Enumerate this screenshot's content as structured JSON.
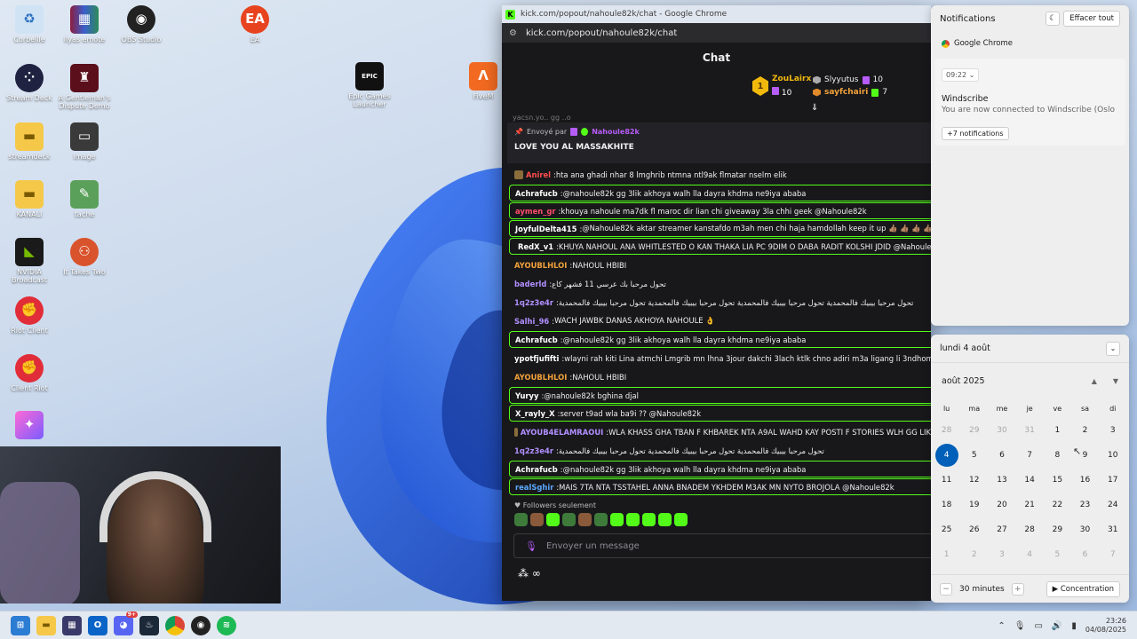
{
  "desktop": {
    "icons": [
      {
        "label": "Corbeille",
        "icon": "recycle-bin-icon"
      },
      {
        "label": "ilyas emote",
        "icon": "winrar-icon"
      },
      {
        "label": "OBS Studio",
        "icon": "obs-icon"
      },
      {
        "label": "EA",
        "icon": "ea-icon"
      },
      {
        "label": "Stream Deck",
        "icon": "stream-deck-icon"
      },
      {
        "label": "A Gentleman's Dispute Demo",
        "icon": "top-hat-icon"
      },
      {
        "label": "Epic Games Launcher",
        "icon": "epic-games-icon"
      },
      {
        "label": "FiveM",
        "icon": "fivem-icon"
      },
      {
        "label": "streamdeck",
        "icon": "folder-icon"
      },
      {
        "label": "image",
        "icon": "image-icon"
      },
      {
        "label": "KANALI",
        "icon": "folder-icon"
      },
      {
        "label": "tache",
        "icon": "image-icon"
      },
      {
        "label": "NVIDIA Broadcast",
        "icon": "nvidia-icon"
      },
      {
        "label": "It Takes Two",
        "icon": "it-takes-two-icon"
      },
      {
        "label": "Riot Client",
        "icon": "riot-icon"
      },
      {
        "label": "Client Riot",
        "icon": "riot-icon"
      }
    ]
  },
  "chrome": {
    "window_title": "kick.com/popout/nahoule82k/chat - Google Chrome",
    "url": "kick.com/popout/nahoule82k/chat",
    "favicon_letter": "K"
  },
  "chat": {
    "header": "Chat",
    "leaderboard": {
      "first": {
        "rank": "1",
        "name": "ZouLairx",
        "count": "10"
      },
      "second": {
        "name": "Slyyutus",
        "count": "10"
      },
      "third": {
        "name": "sayfchairi",
        "count": "7"
      }
    },
    "cut_line": "yacsn.yo.. gg ..o",
    "pinned": {
      "sent_by": "Envoyé par",
      "user": "Nahoule82k",
      "message": "LOVE YOU AL MASSAKHITE"
    },
    "messages": [
      {
        "user": "Anirel",
        "color": "#ff4d4d",
        "text": "hta ana ghadi nhar 8 lmghrib ntmna ntl9ak flmatar nselm elik",
        "hl": false,
        "badge": "#8a6d3b"
      },
      {
        "user": "Achrafucb",
        "color": "#ffffff",
        "text": "@nahoule82k gg 3lik akhoya walh lla dayra khdma ne9iya ababa",
        "hl": true,
        "badge": ""
      },
      {
        "user": "aymen_gr",
        "color": "#ff4d6a",
        "text": "khouya nahoule ma7dk fl maroc dir lian chi giveaway 3la chhi geek @Nahoule82k",
        "hl": true,
        "badge": ""
      },
      {
        "user": "JoyfulDelta415",
        "color": "#ffffff",
        "text": "@Nahoule82k aktar streamer kanstafdo m3ah men chi haja hamdollah keep it up 👍🏽 👍🏽 👍🏽 👍🏽 👍🏽",
        "hl": true,
        "badge": ""
      },
      {
        "user": "RedX_v1",
        "color": "#ffffff",
        "text": "KHUYA NAHOUL ANA WHITLESTED O KAN THAKA LIA PC 9DIM O DABA RADIT KOLSHI JDID @Nahoule82k",
        "hl": true,
        "badge": "#e7c04a"
      },
      {
        "user": "AYOUBLHLOI",
        "color": "#f2a23a",
        "text": "NAHOUL HBIBI",
        "hl": false,
        "badge": ""
      },
      {
        "user": "baderld",
        "color": "#b18fff",
        "text": "تحول مرحبا بك عرسي 11 فشهر كاع",
        "hl": false,
        "badge": ""
      },
      {
        "user": "1q2z3e4r",
        "color": "#b18fff",
        "text": "تحول مرحبا بيبيك فالمحمدية تحول مرحبا بيبيك فالمحمدية تحول مرحبا بيبيك فالمحمدية تحول مرحبا بيبيك فالمحمدية",
        "hl": false,
        "badge": ""
      },
      {
        "user": "Salhi_96",
        "color": "#b18fff",
        "text": "WACH JAWBK DANAS AKHOYA NAHOULE 👌",
        "hl": false,
        "badge": ""
      },
      {
        "user": "Achrafucb",
        "color": "#ffffff",
        "text": "@nahoule82k gg 3lik akhoya walh lla dayra khdma ne9iya ababa",
        "hl": true,
        "badge": ""
      },
      {
        "user": "ypotfjufifti",
        "color": "#ffffff",
        "text": "wlayni rah kiti Lina atmchi Lmgrib mn lhna 3jour dakchi 3lach ktlk chno adiri m3a ligang li 3ndhom slota",
        "hl": false,
        "badge": ""
      },
      {
        "user": "AYOUBLHLOI",
        "color": "#f2a23a",
        "text": "NAHOUL HBIBI",
        "hl": false,
        "badge": ""
      },
      {
        "user": "Yuryy",
        "color": "#ffffff",
        "text": "@nahoule82k bghina djal",
        "hl": true,
        "badge": ""
      },
      {
        "user": "X_rayly_X",
        "color": "#ffffff",
        "text": "server t9ad wla ba9i ?? @Nahoule82k",
        "hl": true,
        "badge": ""
      },
      {
        "user": "AYOUB4ELAMRAOUI",
        "color": "#b18fff",
        "text": "WLA KHASS GHA TBAN F KHBAREK NTA A9AL WAHD KAY POSTI F STORIES WLH GG LIK",
        "hl": false,
        "badge": "#8a6d3b"
      },
      {
        "user": "1q2z3e4r",
        "color": "#b18fff",
        "text": "تحول مرحبا بيبيك فالمحمدية تحول مرحبا بيبيك فالمحمدية تحول مرحبا بيبيك فالمحمدية",
        "hl": false,
        "badge": ""
      },
      {
        "user": "Achrafucb",
        "color": "#ffffff",
        "text": "@nahoule82k gg 3lik akhoya walh lla dayra khdma ne9iya ababa",
        "hl": true,
        "badge": ""
      },
      {
        "user": "realSghir",
        "color": "#5aa9ff",
        "text": "MAIS 7TA NTA TSSTAHEL ANNA BNADEM YKHDEM M3AK MN NYTO BROJOLA @Nahoule82k",
        "hl": true,
        "badge": ""
      }
    ],
    "followers_only": "Followers seulement",
    "input_placeholder": "Envoyer un message"
  },
  "notifications": {
    "title": "Notifications",
    "clear_all": "Effacer tout",
    "app": "Google Chrome",
    "time": "09:22",
    "card_title": "Windscribe",
    "card_body": "You are now connected to Windscribe (Oslo",
    "more": "+7 notifications"
  },
  "calendar": {
    "date_header": "lundi 4 août",
    "month": "août 2025",
    "weekdays": [
      "lu",
      "ma",
      "me",
      "je",
      "ve",
      "sa",
      "di"
    ],
    "days": [
      [
        "28",
        "out"
      ],
      [
        "29",
        "out"
      ],
      [
        "30",
        "out"
      ],
      [
        "31",
        "out"
      ],
      [
        "1",
        ""
      ],
      [
        "2",
        ""
      ],
      [
        "3",
        ""
      ],
      [
        "4",
        "today"
      ],
      [
        "5",
        ""
      ],
      [
        "6",
        ""
      ],
      [
        "7",
        ""
      ],
      [
        "8",
        ""
      ],
      [
        "9",
        ""
      ],
      [
        "10",
        ""
      ],
      [
        "11",
        ""
      ],
      [
        "12",
        ""
      ],
      [
        "13",
        ""
      ],
      [
        "14",
        ""
      ],
      [
        "15",
        ""
      ],
      [
        "16",
        ""
      ],
      [
        "17",
        ""
      ],
      [
        "18",
        ""
      ],
      [
        "19",
        ""
      ],
      [
        "20",
        ""
      ],
      [
        "21",
        ""
      ],
      [
        "22",
        ""
      ],
      [
        "23",
        ""
      ],
      [
        "24",
        ""
      ],
      [
        "25",
        ""
      ],
      [
        "26",
        ""
      ],
      [
        "27",
        ""
      ],
      [
        "28",
        ""
      ],
      [
        "29",
        ""
      ],
      [
        "30",
        ""
      ],
      [
        "31",
        ""
      ],
      [
        "1",
        "out"
      ],
      [
        "2",
        "out"
      ],
      [
        "3",
        "out"
      ],
      [
        "4",
        "out"
      ],
      [
        "5",
        "out"
      ],
      [
        "6",
        "out"
      ],
      [
        "7",
        "out"
      ]
    ],
    "focus_minutes": "30 minutes",
    "focus_button": "Concentration"
  },
  "taskbar": {
    "time": "23:26",
    "date": "04/08/2025",
    "discord_badge": "9+"
  }
}
